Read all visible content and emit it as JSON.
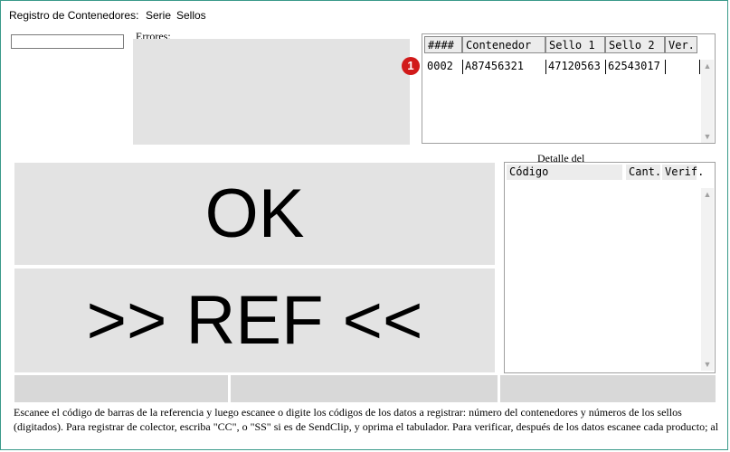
{
  "menu": {
    "title": "Registro de Contenedores:",
    "serie": "Serie",
    "sellos": "Sellos"
  },
  "input": {
    "value": ""
  },
  "errors": {
    "label": "Errores:"
  },
  "grid": {
    "headers": [
      "####",
      "Contenedor",
      "Sello 1",
      "Sello 2",
      "Ver."
    ],
    "rows": [
      {
        "num": "0002",
        "contenedor": "A87456321",
        "sello1": "47120563",
        "sello2": "62543017",
        "ver": ""
      }
    ]
  },
  "badge": "1",
  "ok_label": "OK",
  "ref_label": ">> REF <<",
  "detail": {
    "label": "Detalle del",
    "headers": [
      "Código",
      "Cant.",
      "Verif."
    ]
  },
  "help_text": "Escanee el código de barras de la referencia y luego escanee o digite los códigos de los datos a registrar: número del contenedores y números de los sellos (digitados). Para registrar de colector, escriba \"CC\", o \"SS\" si es de SendClip, y oprima el tabulador. Para verificar, después de los datos escanee cada producto; al",
  "colors": {
    "panel": "#e3e3e3",
    "badge": "#d11a1a",
    "border": "#3a9a8a"
  }
}
